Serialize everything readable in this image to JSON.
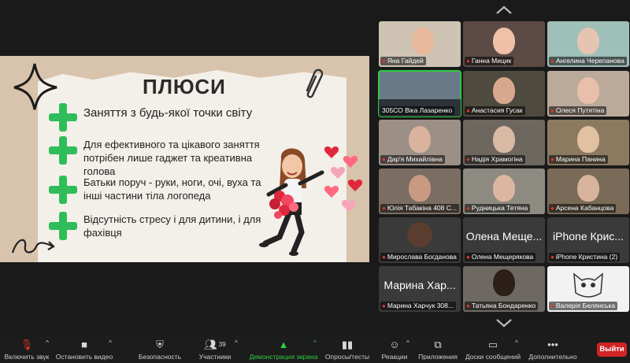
{
  "slide": {
    "title": "ПЛЮСИ",
    "bullets": [
      "Заняття з будь-якої точки світу",
      "Для ефективного та цікавого заняття потрібен лише гаджет та креативна голова",
      "Батьки поруч - руки, ноги, очі, вуха та інші частини тіла логопеда",
      "Відсутність стресу і для дитини, і для фахівця"
    ]
  },
  "gallery": {
    "participants": [
      {
        "name": "Яна Гайдей"
      },
      {
        "name": "Ганна Мицик"
      },
      {
        "name": "Ангелина Черепанова"
      },
      {
        "name": "305СО Віка Лазаренко"
      },
      {
        "name": "Анастасия Гусак"
      },
      {
        "name": "Олеся Путятіна"
      },
      {
        "name": "Дар'я Михайлівна"
      },
      {
        "name": "Надія Храмогіна"
      },
      {
        "name": "Марина Панина"
      },
      {
        "name": "Юлія Табакіна 408 С..."
      },
      {
        "name": "Рудницька Тетяна"
      },
      {
        "name": "Арсена Кабанцова"
      },
      {
        "name": "Мирослава Богданова"
      },
      {
        "name": "Олена Мещерякова",
        "big": "Олена Меще..."
      },
      {
        "name": "iPhone Кристина (2)",
        "big": "iPhone Крис..."
      },
      {
        "name": "Марина Харчук 308...",
        "big": "Марина Хар..."
      },
      {
        "name": "Татьяна Бондаренко"
      },
      {
        "name": "Валерія Белянська"
      }
    ]
  },
  "toolbar": {
    "audio": "Включить звук",
    "video": "Остановить видео",
    "security": "Безопасность",
    "participants": "Участники",
    "participants_count": "39",
    "share": "Демонстрация экрана",
    "polls": "Опросы/тесты",
    "reactions": "Реакции",
    "apps": "Приложения",
    "whiteboards": "Доски сообщений",
    "more": "Дополнительно",
    "leave": "Выйти"
  },
  "colors": {
    "accent_green": "#2ebd5a",
    "share_green": "#2ecc40",
    "leave_red": "#d12424"
  }
}
